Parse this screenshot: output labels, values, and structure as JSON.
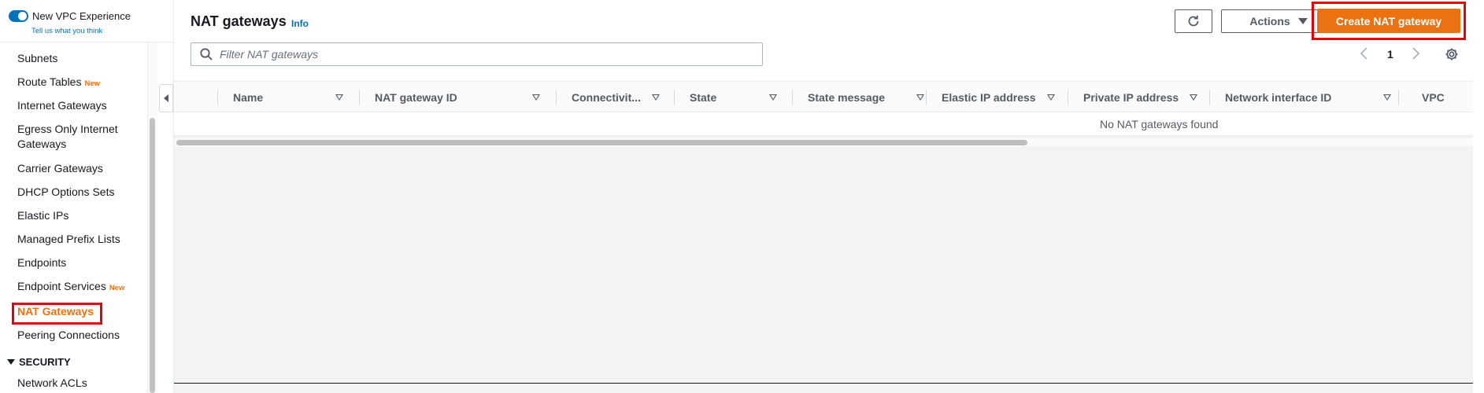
{
  "sidebar": {
    "toggle_label": "New VPC Experience",
    "feedback_link": "Tell us what you think",
    "items": [
      {
        "label": "Subnets",
        "badge": ""
      },
      {
        "label": "Route Tables",
        "badge": "New"
      },
      {
        "label": "Internet Gateways",
        "badge": ""
      },
      {
        "label": "Egress Only Internet Gateways",
        "badge": ""
      },
      {
        "label": "Carrier Gateways",
        "badge": ""
      },
      {
        "label": "DHCP Options Sets",
        "badge": ""
      },
      {
        "label": "Elastic IPs",
        "badge": ""
      },
      {
        "label": "Managed Prefix Lists",
        "badge": ""
      },
      {
        "label": "Endpoints",
        "badge": ""
      },
      {
        "label": "Endpoint Services",
        "badge": "New"
      },
      {
        "label": "NAT Gateways",
        "badge": ""
      },
      {
        "label": "Peering Connections",
        "badge": ""
      }
    ],
    "section_security": "SECURITY",
    "security_items": [
      {
        "label": "Network ACLs"
      }
    ]
  },
  "header": {
    "title": "NAT gateways",
    "info": "Info",
    "actions_label": "Actions",
    "create_label": "Create NAT gateway"
  },
  "search": {
    "placeholder": "Filter NAT gateways"
  },
  "pagination": {
    "current_page": "1"
  },
  "table": {
    "columns": [
      "Name",
      "NAT gateway ID",
      "Connectivit...",
      "State",
      "State message",
      "Elastic IP address",
      "Private IP address",
      "Network interface ID",
      "VPC"
    ],
    "empty_message": "No NAT gateways found"
  },
  "colors": {
    "accent_orange": "#ec7211",
    "link_blue": "#0073bb",
    "highlight_red": "#e5000b"
  },
  "icons": [
    "toggle-switch",
    "collapse-panel-icon",
    "refresh-icon",
    "caret-down-icon",
    "search-icon",
    "chevron-left-icon",
    "chevron-right-icon",
    "gear-icon"
  ]
}
